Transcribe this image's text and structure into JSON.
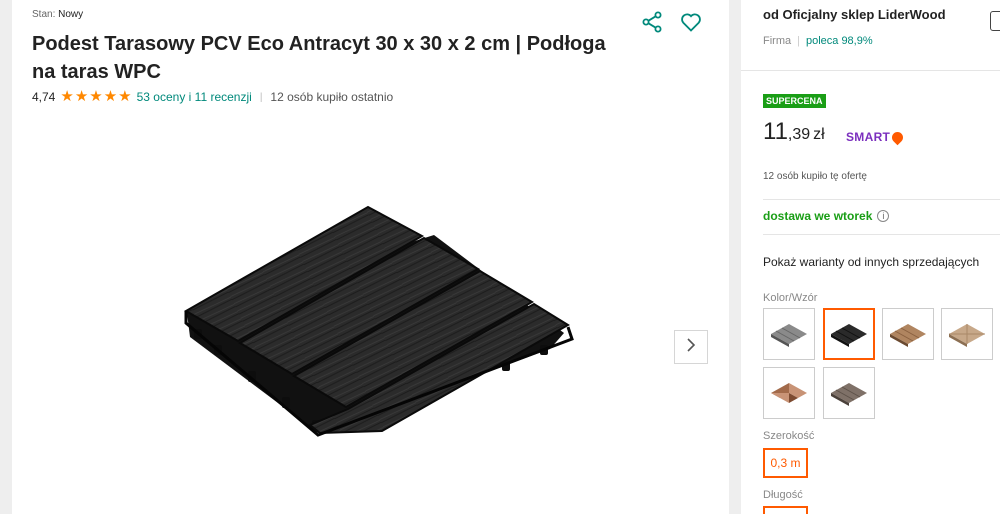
{
  "product": {
    "condition_label": "Stan:",
    "condition_value": "Nowy",
    "title": "Podest Tarasowy PCV Eco Antracyt 30 x 30 x 2 cm | Podłoga na taras WPC",
    "rating_value": "4,74",
    "stars": 5,
    "reviews_link": "53 oceny i 11 recenzji",
    "bought_recently": "12 osób kupiło ostatnio",
    "image_icon": "deck-tile-image",
    "next_icon": "chevron-right-icon"
  },
  "offer": {
    "seller": "od Oficjalny sklep LiderWood",
    "seller_type": "Firma",
    "seller_rating": "poleca 98,9%",
    "badge": "SUPERCENA",
    "price_int": "11",
    "price_dec": ",39",
    "currency": "zł",
    "smart_label": "SMART",
    "offer_bought": "12 osób kupiło tę ofertę",
    "delivery": "dostawa we wtorek",
    "info_glyph": "i",
    "other_sellers": "Pokaż warianty od innych sprzedających",
    "color_label": "Kolor/Wzór",
    "width_label": "Szerokość",
    "width_value": "0,3 m",
    "length_label": "Długość"
  },
  "colors": {
    "accent": "#ff5a00",
    "green": "#1a9e16",
    "teal": "#00897b",
    "star": "#ff8800",
    "smart_purple": "#7b2fbe"
  }
}
